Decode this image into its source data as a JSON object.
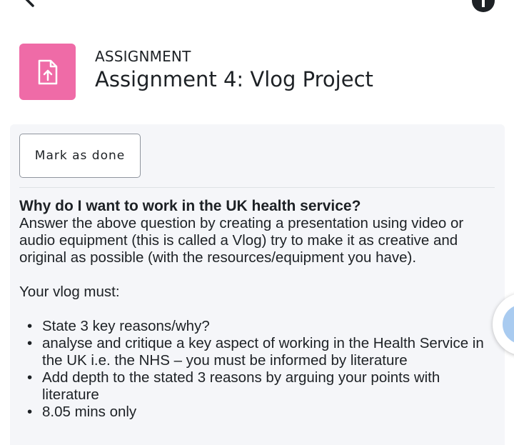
{
  "nav": {
    "back_icon": "arrow-left-icon",
    "info_icon": "info-icon"
  },
  "header": {
    "icon": "assignment-upload-icon",
    "icon_bg_color": "#ef6ba7",
    "label": "ASSIGNMENT",
    "title": "Assignment 4: Vlog Project"
  },
  "completion": {
    "mark_done_label": "Mark as done"
  },
  "description": {
    "question": "Why do I want to work in the UK health service?",
    "instructions": "Answer the above question by creating a presentation using video or audio equipment (this is called a Vlog) try to make it as creative and original as possible (with the resources/equipment you have).",
    "must_intro": "Your vlog must:",
    "requirements": [
      "State 3 key reasons/why?",
      "analyse and critique a key aspect of working in the Health Service in the UK i.e. the NHS – you must be informed by literature",
      "Add depth to the stated 3 reasons by arguing your points with literature",
      "8.05 mins only"
    ]
  },
  "colors": {
    "panel_bg": "#f5f6f9",
    "text": "#1d2125",
    "button_border": "#8f959e"
  }
}
